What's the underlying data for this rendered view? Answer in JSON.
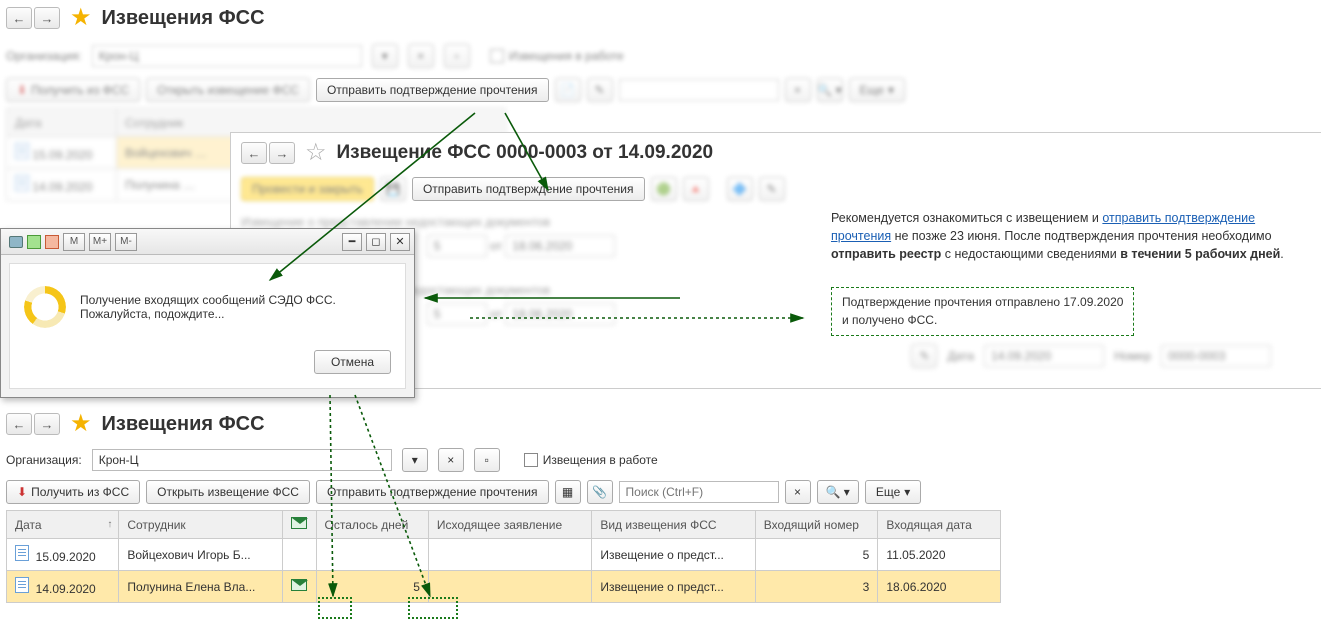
{
  "top": {
    "title": "Извещения ФСС",
    "org_label": "Организация:",
    "org_value": "Крон-Ц",
    "in_work_label": "Извещения в работе",
    "btn_get": "Получить из ФСС",
    "btn_open": "Открыть извещение ФСС",
    "btn_send": "Отправить подтверждение прочтения",
    "search_ph": "Поиск (Ctrl+F)",
    "more_label": "Еще"
  },
  "top_headers": {
    "date": "Дата",
    "employee": "Сотрудник"
  },
  "top_rows": [
    {
      "date": "15.09.2020",
      "emp": "Войцехович …"
    },
    {
      "date": "14.09.2020",
      "emp": "Полунина …"
    }
  ],
  "sub": {
    "title": "Извещение ФСС 0000-0003 от 14.09.2020",
    "btn_record": "Провести и закрыть",
    "btn_send": "Отправить подтверждение прочтения",
    "rec_pre": "Рекомендуется ознакомиться с извещением и ",
    "rec_link": "отправить подтверждение прочтения",
    "rec_mid": " не позже 23 июня. После подтверждения прочтения необходимо ",
    "rec_bold1": "отправить реестр",
    "rec_mid2": " с недостающими сведениями ",
    "rec_bold2": "в течении 5 рабочих дней",
    "confirm_box_1": "Подтверждение прочтения отправлено 17.09.2020",
    "confirm_box_2": "и получено ФСС.",
    "date_label": "Дата",
    "date_val": "14.09.2020",
    "num_label": "Номер",
    "num_val": "0000-0003"
  },
  "dlg": {
    "line1": "Получение входящих сообщений СЭДО ФСС.",
    "line2": "Пожалуйста, подождите...",
    "cancel": "Отмена",
    "m": "М",
    "mp": "М+",
    "mm": "М-"
  },
  "bottom": {
    "title": "Извещения ФСС",
    "org_label": "Организация:",
    "org_value": "Крон-Ц",
    "in_work_label": "Извещения в работе",
    "btn_get": "Получить из ФСС",
    "btn_open": "Открыть извещение ФСС",
    "btn_send": "Отправить подтверждение прочтения",
    "search_ph": "Поиск (Ctrl+F)",
    "more_label": "Еще"
  },
  "table": {
    "headers": {
      "date": "Дата",
      "employee": "Сотрудник",
      "days_left": "Осталось дней",
      "outgoing": "Исходящее заявление",
      "kind": "Вид извещения ФСС",
      "in_num": "Входящий номер",
      "in_date": "Входящая дата"
    },
    "rows": [
      {
        "date": "15.09.2020",
        "employee": "Войцехович Игорь Б...",
        "days": "",
        "outgoing": "",
        "kind": "Извещение о предст...",
        "in_num": "5",
        "in_date": "11.05.2020"
      },
      {
        "date": "14.09.2020",
        "employee": "Полунина Елена Вла...",
        "days": "5",
        "outgoing": "",
        "kind": "Извещение о предст...",
        "in_num": "3",
        "in_date": "18.06.2020"
      }
    ]
  }
}
